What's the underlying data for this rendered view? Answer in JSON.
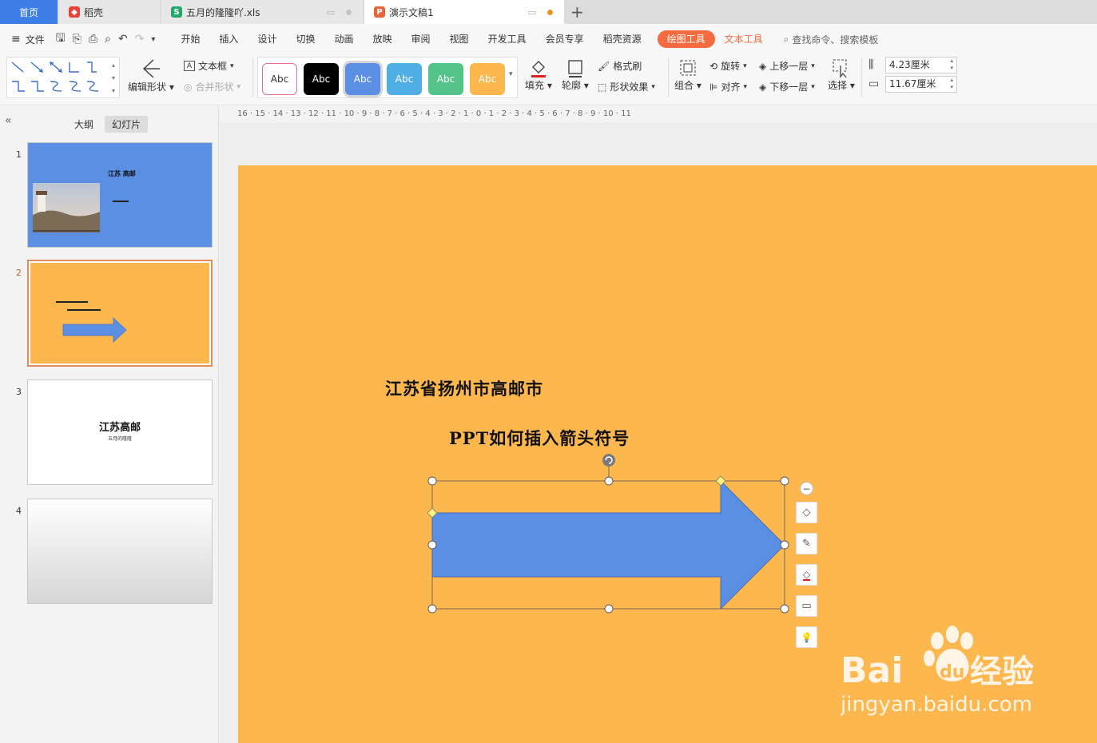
{
  "tabs": [
    {
      "label": "首页"
    },
    {
      "label": "稻壳"
    },
    {
      "label": "五月的隆隆吖.xls"
    },
    {
      "label": "演示文稿1"
    }
  ],
  "menubar": {
    "file_label": "文件",
    "items": [
      "开始",
      "插入",
      "设计",
      "切换",
      "动画",
      "放映",
      "审阅",
      "视图",
      "开发工具",
      "会员专享",
      "稻壳资源"
    ],
    "drawing_tools": "绘图工具",
    "text_tools": "文本工具",
    "search_placeholder": "查找命令、搜索模板"
  },
  "ribbon": {
    "edit_shape": "编辑形状",
    "text_box": "文本框",
    "merge_shape": "合并形状",
    "style_chips": [
      "Abc",
      "Abc",
      "Abc",
      "Abc",
      "Abc",
      "Abc"
    ],
    "fill": "填充",
    "outline": "轮廓",
    "format_painter": "格式刷",
    "shape_effect": "形状效果",
    "group": "组合",
    "rotate": "旋转",
    "align": "对齐",
    "bring_forward": "上移一层",
    "send_backward": "下移一层",
    "select": "选择",
    "height_value": "4.23厘米",
    "width_value": "11.67厘米"
  },
  "leftpanel": {
    "outline_tab": "大纲",
    "slides_tab": "幻灯片",
    "slide_numbers": [
      "1",
      "2",
      "3",
      "4"
    ],
    "slide1_title": "江苏 高邮",
    "slide3_title": "江苏高邮",
    "slide3_sub": "五月的隆隆"
  },
  "ruler": {
    "labels": "16 · 15 · 14 · 13 · 12 · 11 · 10 · 9 · 8 · 7 · 6 · 5 · 4 · 3 · 2 · 1 · 0 · 1 · 2 · 3 · 4 · 5 · 6 · 7 · 8 · 9 · 10 · 11"
  },
  "slide": {
    "title": "江苏省扬州市高邮市",
    "subtitle": "PPT如何插入箭头符号",
    "background": "#fdb74f",
    "arrow_color": "#5b8fe3"
  },
  "watermark": {
    "brand": "Bai",
    "brand2": "du",
    "cn": "经验",
    "url": "jingyan.baidu.com"
  },
  "colors": {
    "accent_orange": "#f36b3f",
    "home_tab": "#3d7fe6"
  }
}
